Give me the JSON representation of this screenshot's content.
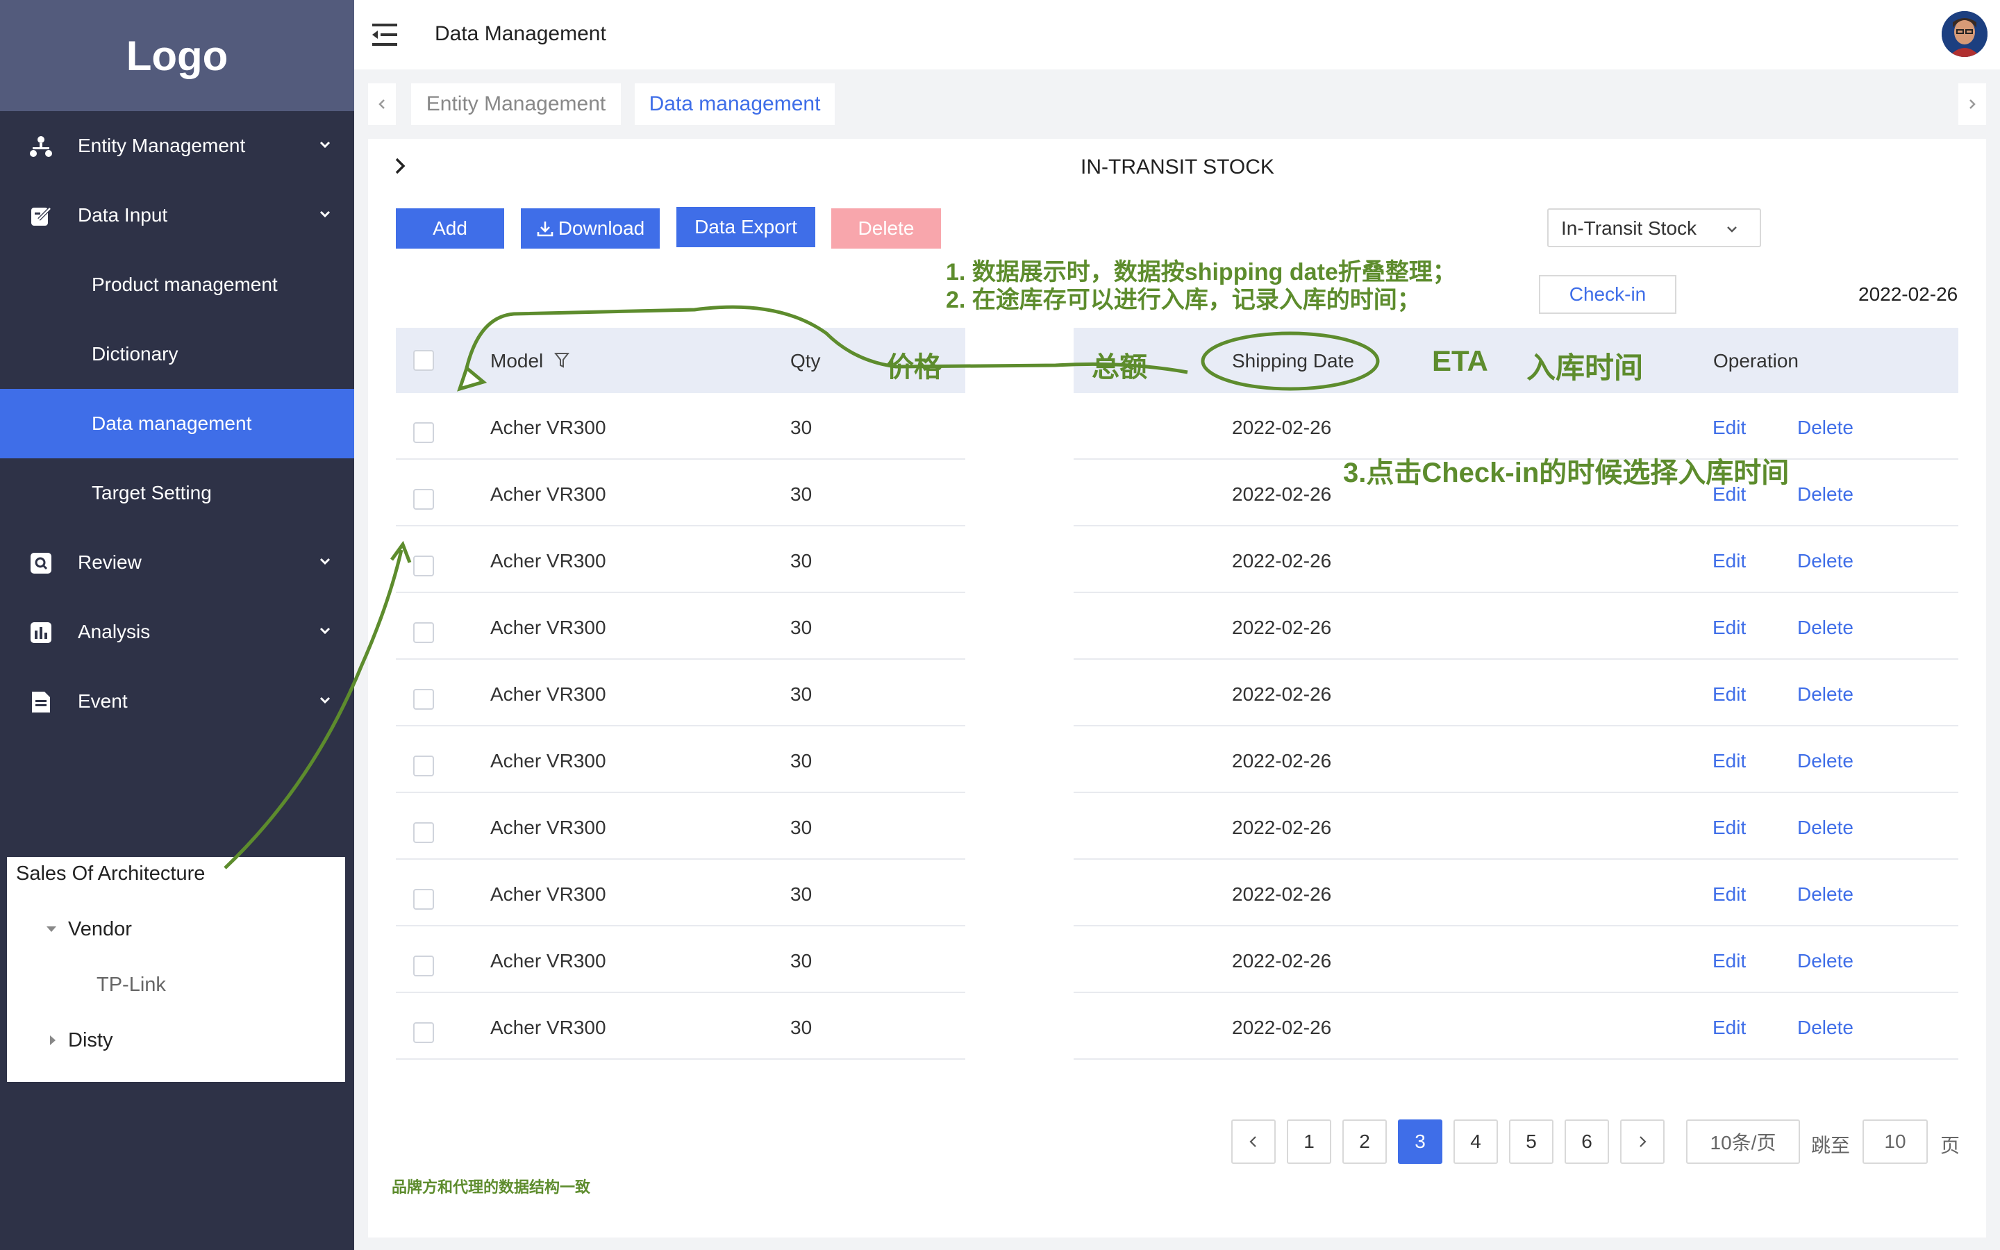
{
  "sidebar": {
    "logo": "Logo",
    "menu": [
      {
        "label": "Entity Management"
      },
      {
        "label": "Data Input"
      },
      {
        "label": "Product management"
      },
      {
        "label": "Dictionary"
      },
      {
        "label": "Data management"
      },
      {
        "label": "Target Setting"
      },
      {
        "label": "Review"
      },
      {
        "label": "Analysis"
      },
      {
        "label": "Event"
      }
    ],
    "tree": {
      "title": "Sales Of Architecture",
      "vendor": "Vendor",
      "tplink": "TP-Link",
      "disty": "Disty"
    }
  },
  "header": {
    "title": "Data Management"
  },
  "tabs": [
    {
      "label": "Entity Management"
    },
    {
      "label": "Data management"
    }
  ],
  "page": {
    "title": "IN-TRANSIT STOCK"
  },
  "toolbar": {
    "add": "Add",
    "download": "Download",
    "export": "Data Export",
    "delete": "Delete",
    "select_value": "In-Transit Stock",
    "checkin": "Check-in",
    "date": "2022-02-26"
  },
  "table": {
    "headers": {
      "model": "Model",
      "qty": "Qty",
      "shipping": "Shipping Date",
      "operation": "Operation"
    },
    "rows": [
      {
        "model": "Acher VR300",
        "qty": "30",
        "date": "2022-02-26",
        "edit": "Edit",
        "delete": "Delete"
      },
      {
        "model": "Acher VR300",
        "qty": "30",
        "date": "2022-02-26",
        "edit": "Edit",
        "delete": "Delete"
      },
      {
        "model": "Acher VR300",
        "qty": "30",
        "date": "2022-02-26",
        "edit": "Edit",
        "delete": "Delete"
      },
      {
        "model": "Acher VR300",
        "qty": "30",
        "date": "2022-02-26",
        "edit": "Edit",
        "delete": "Delete"
      },
      {
        "model": "Acher VR300",
        "qty": "30",
        "date": "2022-02-26",
        "edit": "Edit",
        "delete": "Delete"
      },
      {
        "model": "Acher VR300",
        "qty": "30",
        "date": "2022-02-26",
        "edit": "Edit",
        "delete": "Delete"
      },
      {
        "model": "Acher VR300",
        "qty": "30",
        "date": "2022-02-26",
        "edit": "Edit",
        "delete": "Delete"
      },
      {
        "model": "Acher VR300",
        "qty": "30",
        "date": "2022-02-26",
        "edit": "Edit",
        "delete": "Delete"
      },
      {
        "model": "Acher VR300",
        "qty": "30",
        "date": "2022-02-26",
        "edit": "Edit",
        "delete": "Delete"
      },
      {
        "model": "Acher VR300",
        "qty": "30",
        "date": "2022-02-26",
        "edit": "Edit",
        "delete": "Delete"
      }
    ]
  },
  "pagination": {
    "pages": [
      "1",
      "2",
      "3",
      "4",
      "5",
      "6"
    ],
    "current": "3",
    "page_size": "10条/页",
    "goto_label": "跳至",
    "goto_value": "10",
    "page_suffix": "页"
  },
  "annotations": {
    "note1": "1. 数据展示时，数据按shipping date折叠整理；",
    "note2": "2. 在途库存可以进行入库，记录入库的时间；",
    "price": "价格",
    "total": "总额",
    "eta": "ETA",
    "checkin_time": "入库时间",
    "note3": "3.点击Check-in的时候选择入库时间",
    "footer": "品牌方和代理的数据结构一致"
  },
  "colors": {
    "sidebar_bg": "#2e3247",
    "logo_bg": "#535b7c",
    "accent": "#3f6ee8",
    "delete_disabled": "#f8a6ac",
    "annotation": "#5d8c2d"
  }
}
